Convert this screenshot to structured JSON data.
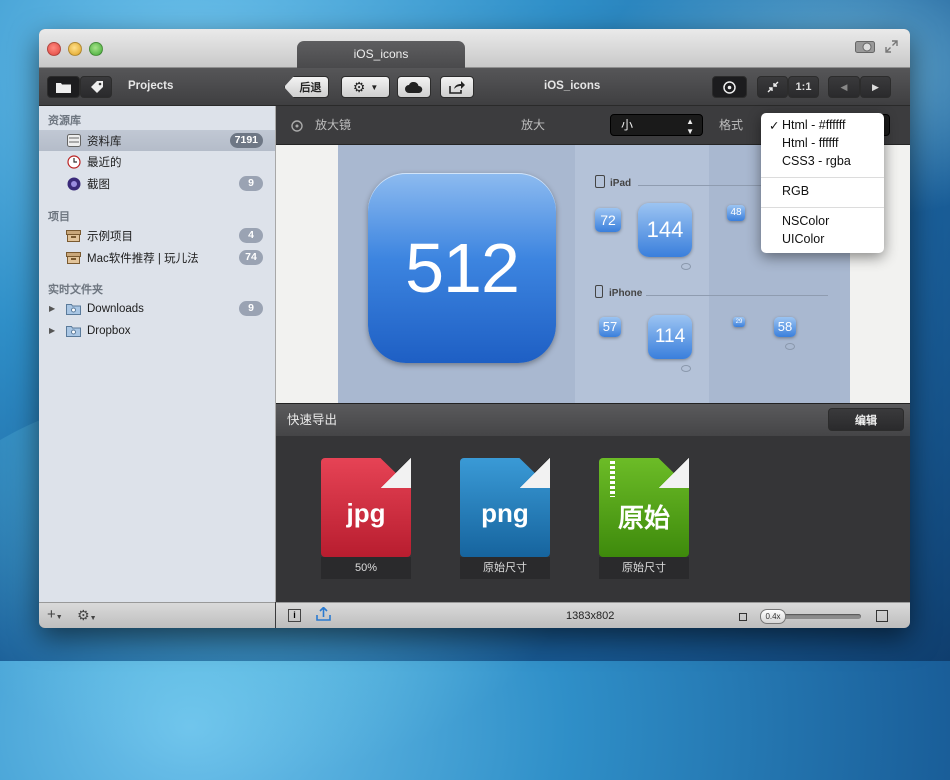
{
  "window": {
    "tab_title": "iOS_icons"
  },
  "toolbar": {
    "projects_label": "Projects",
    "back_label": "后退",
    "center_title": "iOS_icons",
    "ratio_label": "1:1"
  },
  "sidebar": {
    "sections": [
      {
        "title": "资源库",
        "items": [
          {
            "label": "资料库",
            "count": "7191",
            "icon": "library-icon",
            "selected": true
          },
          {
            "label": "最近的",
            "count": "",
            "icon": "clock-icon"
          },
          {
            "label": "截图",
            "count": "9",
            "icon": "screenshot-icon"
          }
        ]
      },
      {
        "title": "项目",
        "items": [
          {
            "label": "示例项目",
            "count": "4",
            "icon": "project-box-icon"
          },
          {
            "label": "Mac软件推荐 | 玩儿法",
            "count": "74",
            "icon": "project-box-icon"
          }
        ]
      },
      {
        "title": "实时文件夹",
        "items": [
          {
            "label": "Downloads",
            "count": "9",
            "icon": "folder-icon"
          },
          {
            "label": "Dropbox",
            "count": "",
            "icon": "folder-icon"
          }
        ]
      }
    ]
  },
  "viewer": {
    "magnifier_label": "放大镜",
    "zoom_label": "放大",
    "size_select": "小",
    "format_label": "格式"
  },
  "preview": {
    "big_icon": "512",
    "ipad_label": "iPad",
    "iphone_label": "iPhone",
    "ipad_icons": [
      "72",
      "144",
      "48"
    ],
    "iphone_icons": [
      "57",
      "114",
      "29",
      "58"
    ]
  },
  "format_menu": {
    "items": [
      "Html - #ffffff",
      "Html - ffffff",
      "CSS3 - rgba",
      "RGB",
      "NSColor",
      "UIColor"
    ],
    "checked": "Html - #ffffff"
  },
  "export": {
    "title": "快速导出",
    "edit_label": "编辑",
    "files": [
      {
        "name": "jpg",
        "caption": "50%",
        "color": "#d6283c"
      },
      {
        "name": "png",
        "caption": "原始尺寸",
        "color": "#1f79b8"
      },
      {
        "name": "原始",
        "caption": "原始尺寸",
        "color": "#4f9a16"
      }
    ]
  },
  "bottom": {
    "dimensions": "1383x802",
    "zoom": "0.4x"
  }
}
